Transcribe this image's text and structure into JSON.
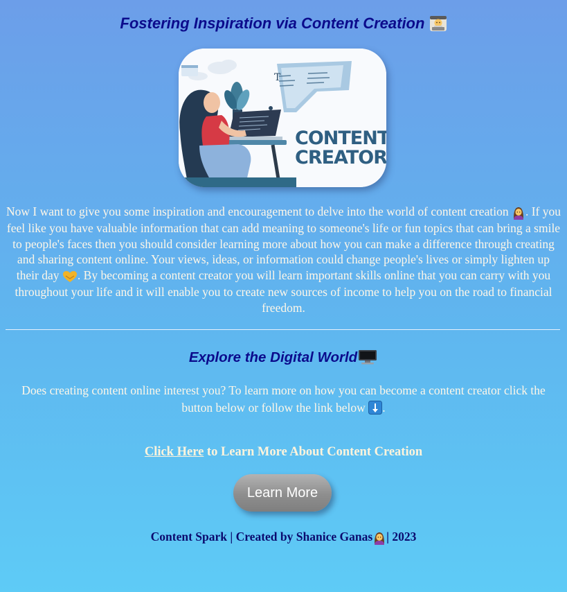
{
  "header": {
    "title": "Fostering Inspiration via Content Creation",
    "title_icon": "man-technologist-emoji"
  },
  "hero": {
    "image_text_line1": "CONTENT",
    "image_text_line2": "CREATOR"
  },
  "intro": {
    "part1": "Now I want to give you some inspiration and encouragement to delve into the world of content creation ",
    "part2": ". If you feel like you have valuable information that can add meaning to someone's life or fun topics that can bring a smile to people's faces then you should consider learning more about how you can make a difference through creating and sharing content online. Your views, ideas, or information could change people's lives or simply lighten up their day ",
    "part3": ". By becoming a content creator you will learn important skills online that you can carry with you throughout your life and it will enable you to create new sources of income to help you on the road to financial freedom.",
    "icon1": "woman-emoji",
    "icon2": "handshake-heart-emoji"
  },
  "explore": {
    "heading": "Explore the Digital World",
    "heading_icon": "desktop-computer-emoji",
    "text_part1": "Does creating content online interest you? To learn more on how you can become a content creator click the button below or follow the link below ",
    "text_part2": ".",
    "arrow_icon": "down-arrow-emoji"
  },
  "cta": {
    "link_label": "Click Here",
    "rest": " to Learn More About Content Creation"
  },
  "button": {
    "label": "Learn More"
  },
  "footer": {
    "part1": "Content Spark | Created by Shanice Ganas",
    "part2": "| 2023",
    "icon": "woman-emoji"
  },
  "colors": {
    "heading": "#0b0b8c",
    "body_text": "#fff7e8",
    "background_top": "#6c9ee9",
    "background_bottom": "#5ecbf6",
    "button": "#8e8e8e"
  }
}
